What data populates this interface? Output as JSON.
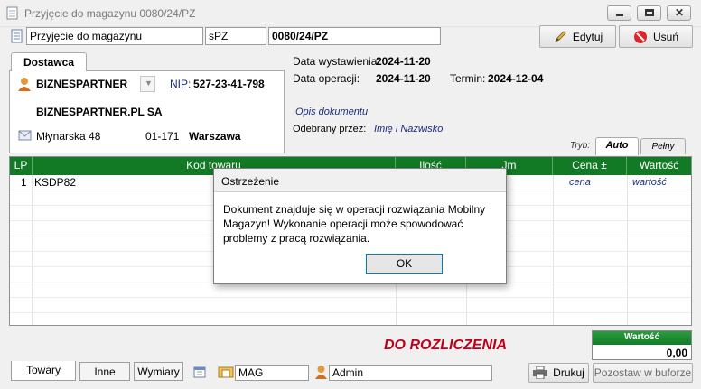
{
  "window": {
    "title": "Przyjęcie do magazynu 0080/24/PZ"
  },
  "header": {
    "doc_type": "Przyjęcie do magazynu",
    "series": "sPZ",
    "number": "0080/24/PZ",
    "edit_label": "Edytuj",
    "delete_label": "Usuń"
  },
  "contractor": {
    "tab_label": "Dostawca",
    "code": "BIZNESPARTNER",
    "nip_label": "NIP:",
    "nip": "527-23-41-798",
    "name": "BIZNESPARTNER.PL SA",
    "street": "Młynarska 48",
    "postal": "01-171",
    "city": "Warszawa"
  },
  "dates": {
    "issue_label": "Data wystawienia:",
    "issue": "2024-11-20",
    "op_label": "Data operacji:",
    "op": "2024-11-20",
    "term_label": "Termin:",
    "term": "2024-12-04"
  },
  "description": {
    "placeholder": "Opis dokumentu",
    "received_label": "Odebrany przez:",
    "received_placeholder": "Imię i Nazwisko"
  },
  "mode": {
    "label": "Tryb:",
    "auto": "Auto",
    "full": "Pełny"
  },
  "grid": {
    "columns": [
      "LP",
      "Kod towaru",
      "Ilość",
      "Jm",
      "Cena ±",
      "Wartość"
    ],
    "rows": [
      {
        "lp": "1",
        "code": "KSDP82",
        "price": "cena",
        "value": "wartość"
      }
    ]
  },
  "status": {
    "text": "DO ROZLICZENIA",
    "total_label": "Wartość",
    "total": "0,00"
  },
  "footer": {
    "tabs": [
      "Towary",
      "Inne",
      "Wymiary"
    ],
    "warehouse": "MAG",
    "user": "Admin",
    "print_label": "Drukuj",
    "buffer_label": "Pozostaw w buforze"
  },
  "dialog": {
    "title": "Ostrzeżenie",
    "message": "Dokument znajduje się w operacji rozwiązania Mobilny Magazyn! Wykonanie operacji może spowodować problemy z pracą rozwiązania.",
    "ok_label": "OK"
  },
  "colors": {
    "grid_header": "#127a25",
    "status_red": "#c0001a",
    "total_header": "#1f8c33"
  }
}
